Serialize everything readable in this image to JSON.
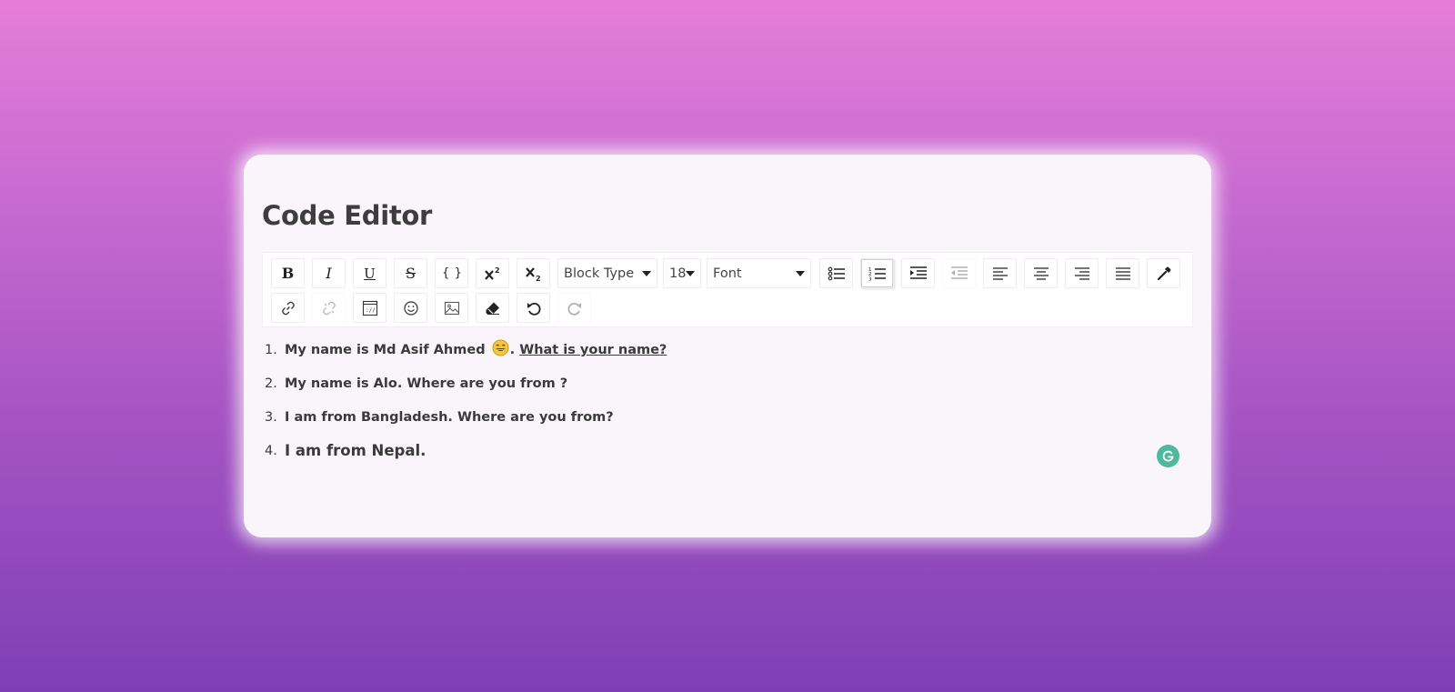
{
  "editor": {
    "title": "Code Editor"
  },
  "toolbar": {
    "bold_label": "B",
    "italic_label": "I",
    "underline_label": "U",
    "strikethrough_label": "S",
    "code_label": "{ }",
    "block_type": "Block Type",
    "font_size": "18",
    "font_family": "Font"
  },
  "content": {
    "items": [
      {
        "number": "1.",
        "text_before": "My name is Md Asif Ahmed ",
        "text_after": ". ",
        "link_text": "What is your name?"
      },
      {
        "number": "2.",
        "text": "My name is Alo. Where are you from ?"
      },
      {
        "number": "3.",
        "text": "I am from Bangladesh. Where are you from?"
      },
      {
        "number": "4.",
        "text": "I am from Nepal."
      }
    ]
  },
  "icons": [
    "bold-icon",
    "italic-icon",
    "underline-icon",
    "strikethrough-icon",
    "code-icon",
    "superscript-icon",
    "subscript-icon",
    "unordered-list-icon",
    "ordered-list-icon",
    "indent-icon",
    "outdent-icon",
    "align-left-icon",
    "align-center-icon",
    "align-right-icon",
    "align-justify-icon",
    "color-picker-icon",
    "link-icon",
    "unlink-icon",
    "embed-icon",
    "emoji-icon",
    "image-icon",
    "eraser-icon",
    "undo-icon",
    "redo-icon",
    "grammarly-icon",
    "grinning-emoji-icon"
  ],
  "colors": {
    "background_top": "#e57dd8",
    "background_bottom": "#7e3fb5",
    "card": "#faf5fa",
    "text": "#3a3a3a",
    "grammarly": "#4fb99e"
  }
}
